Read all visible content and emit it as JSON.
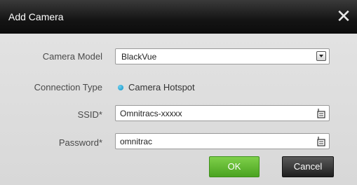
{
  "window": {
    "title": "Add Camera",
    "close_glyph": "✕"
  },
  "form": {
    "camera_model": {
      "label": "Camera Model",
      "value": "BlackVue"
    },
    "connection_type": {
      "label": "Connection Type",
      "option": "Camera Hotspot",
      "selected": true
    },
    "ssid": {
      "label": "SSID*",
      "value": "Omnitracs-xxxxx"
    },
    "password": {
      "label": "Password*",
      "value": "omnitrac"
    }
  },
  "buttons": {
    "ok_label": "OK",
    "cancel_label": "Cancel"
  },
  "colors": {
    "accent_ok": "#5cb82c",
    "radio": "#1aa0d0"
  }
}
